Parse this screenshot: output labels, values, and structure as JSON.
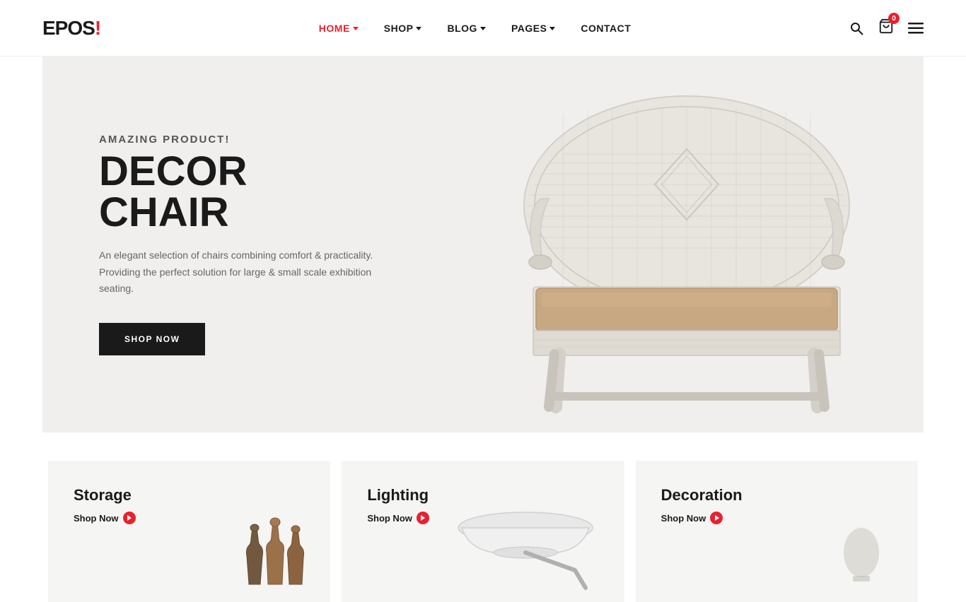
{
  "brand": {
    "name": "EPOS",
    "exclamation": "!"
  },
  "nav": {
    "items": [
      {
        "label": "HOME",
        "hasDropdown": true,
        "active": true
      },
      {
        "label": "SHOP",
        "hasDropdown": true,
        "active": false
      },
      {
        "label": "BLOG",
        "hasDropdown": true,
        "active": false
      },
      {
        "label": "PAGES",
        "hasDropdown": true,
        "active": false
      },
      {
        "label": "CONTACT",
        "hasDropdown": false,
        "active": false
      }
    ]
  },
  "header": {
    "cart_count": "0"
  },
  "hero": {
    "subtitle": "AMAZING PRODUCT!",
    "title": "DECOR CHAIR",
    "description": "An elegant selection of chairs combining comfort & practicality. Providing the perfect solution for large & small scale exhibition seating.",
    "cta_label": "SHOP NOW"
  },
  "categories": [
    {
      "title": "Storage",
      "link_label": "Shop Now"
    },
    {
      "title": "Lighting",
      "link_label": "Shop Now"
    },
    {
      "title": "Decoration",
      "link_label": "Shop Now"
    }
  ]
}
